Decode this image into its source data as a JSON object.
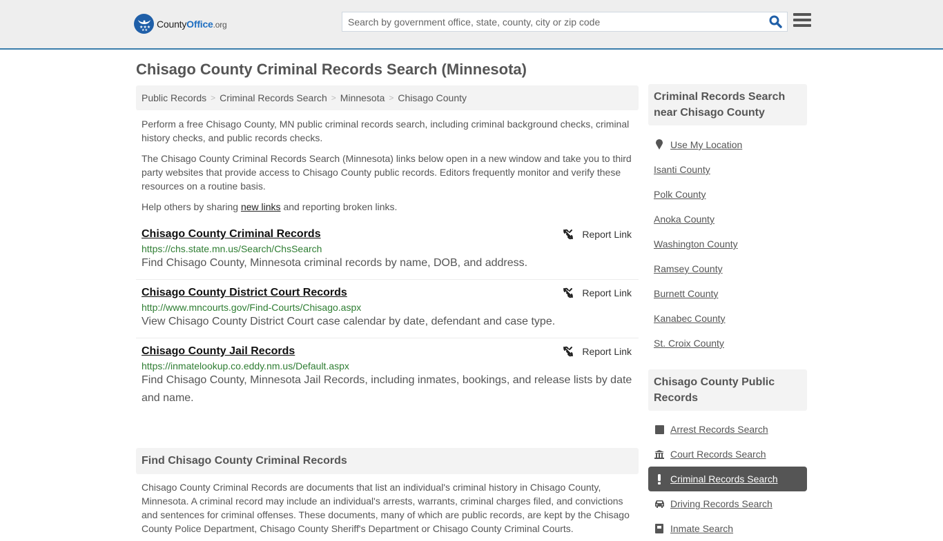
{
  "header": {
    "logo": {
      "part1": "County",
      "part2": "Office",
      "part3": ".org"
    },
    "search": {
      "placeholder": "Search by government office, state, county, city or zip code",
      "value": ""
    },
    "icons": {
      "search": "search-icon",
      "menu": "hamburger-menu-icon"
    },
    "colors": {
      "accent": "#3a7dab",
      "brand": "#1f5fa8"
    }
  },
  "page": {
    "title": "Chisago County Criminal Records Search (Minnesota)"
  },
  "breadcrumb": [
    {
      "label": "Public Records"
    },
    {
      "label": "Criminal Records Search"
    },
    {
      "label": "Minnesota"
    },
    {
      "label": "Chisago County"
    }
  ],
  "intro": {
    "p1": "Perform a free Chisago County, MN public criminal records search, including criminal background checks, criminal history checks, and public records checks.",
    "p2": "The Chisago County Criminal Records Search (Minnesota) links below open in a new window and take you to third party websites that provide access to Chisago County public records. Editors frequently monitor and verify these resources on a routine basis.",
    "p3_before": "Help others by sharing ",
    "p3_link": "new links",
    "p3_after": " and reporting broken links."
  },
  "records": [
    {
      "title": "Chisago County Criminal Records",
      "url": "https://chs.state.mn.us/Search/ChsSearch",
      "description": "Find Chisago County, Minnesota criminal records by name, DOB, and address.",
      "report_label": "Report Link"
    },
    {
      "title": "Chisago County District Court Records",
      "url": "http://www.mncourts.gov/Find-Courts/Chisago.aspx",
      "description": "View Chisago County District Court case calendar by date, defendant and case type.",
      "report_label": "Report Link"
    },
    {
      "title": "Chisago County Jail Records",
      "url": "https://inmatelookup.co.eddy.nm.us/Default.aspx",
      "description": "Find Chisago County, Minnesota Jail Records, including inmates, bookings, and release lists by date and name.",
      "report_label": "Report Link"
    }
  ],
  "find_section": {
    "heading": "Find Chisago County Criminal Records",
    "text": "Chisago County Criminal Records are documents that list an individual's criminal history in Chisago County, Minnesota. A criminal record may include an individual's arrests, warrants, criminal charges filed, and convictions and sentences for criminal offenses. These documents, many of which are public records, are kept by the Chisago County Police Department, Chisago County Sheriff's Department or Chisago County Criminal Courts."
  },
  "sidebar": {
    "nearby": {
      "heading": "Criminal Records Search near Chisago County",
      "use_location": "Use My Location",
      "items": [
        "Isanti County",
        "Polk County",
        "Anoka County",
        "Washington County",
        "Ramsey County",
        "Burnett County",
        "Kanabec County",
        "St. Croix County"
      ]
    },
    "public_records": {
      "heading": "Chisago County Public Records",
      "items": [
        {
          "label": "Arrest Records Search",
          "icon": "square-icon",
          "active": false
        },
        {
          "label": "Court Records Search",
          "icon": "courthouse-icon",
          "active": false
        },
        {
          "label": "Criminal Records Search",
          "icon": "exclamation-icon",
          "active": true
        },
        {
          "label": "Driving Records Search",
          "icon": "car-icon",
          "active": false
        },
        {
          "label": "Inmate Search",
          "icon": "inmate-icon",
          "active": false
        }
      ]
    }
  }
}
